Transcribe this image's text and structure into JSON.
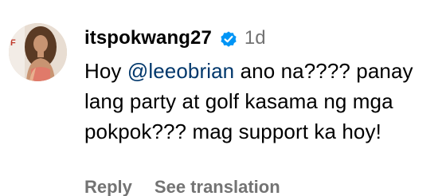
{
  "comment": {
    "username": "itspokwang27",
    "verified_icon": "verified-badge-icon",
    "age": "1d",
    "text": {
      "line1_prefix": "Hoy ",
      "mention": "@leeobrian",
      "line1_suffix": " ano na???? panay",
      "line2": "lang party at golf kasama ng mga",
      "line3": "pokpok??? mag support ka hoy!"
    },
    "actions": {
      "reply": "Reply",
      "translate": "See translation"
    }
  },
  "colors": {
    "mention": "#00376b",
    "secondary_text": "#737373",
    "verified_badge": "#0095f6"
  }
}
